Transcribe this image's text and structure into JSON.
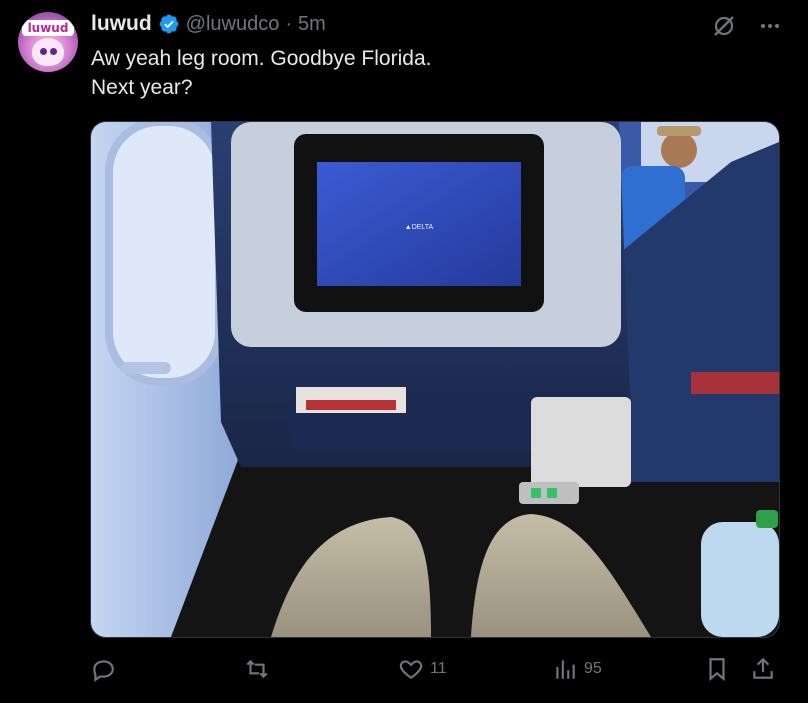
{
  "tweet": {
    "author_name": "luwud",
    "handle": "@luwudco",
    "separator": "·",
    "time": "5m",
    "text": "Aw yeah leg room. Goodbye Florida.\nNext year?",
    "avatar_text": "luwud",
    "media_text": "▲DELTA"
  },
  "actions": {
    "reply_count": "",
    "retweet_count": "",
    "like_count": "11",
    "views_count": "95"
  },
  "colors": {
    "background": "#000000",
    "text": "#e7e9ea",
    "muted": "#71767b",
    "verified": "#1d9bf0"
  },
  "icons": [
    "verified-badge-icon",
    "grok-icon",
    "more-icon",
    "reply-icon",
    "retweet-icon",
    "like-icon",
    "views-icon",
    "bookmark-icon",
    "share-icon"
  ]
}
